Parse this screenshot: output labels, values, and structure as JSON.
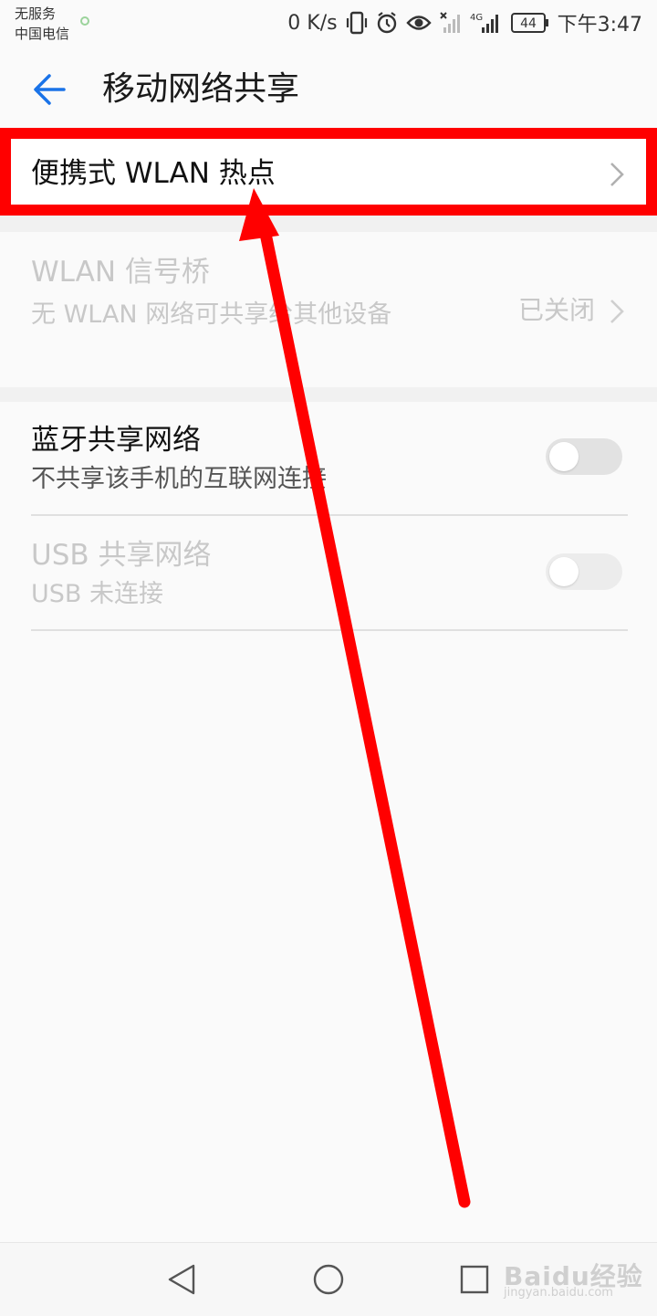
{
  "status_bar": {
    "carrier_line1": "无服务",
    "carrier_line2": "中国电信",
    "speed": "0 K/s",
    "network_type": "4G",
    "battery": "44",
    "time": "下午3:47"
  },
  "header": {
    "title": "移动网络共享"
  },
  "items": {
    "hotspot": {
      "label": "便携式 WLAN 热点"
    },
    "wlan_bridge": {
      "label": "WLAN 信号桥",
      "subtitle": "无 WLAN 网络可共享给其他设备",
      "value": "已关闭",
      "enabled": false
    },
    "bluetooth": {
      "label": "蓝牙共享网络",
      "subtitle": "不共享该手机的互联网连接",
      "on": false
    },
    "usb": {
      "label": "USB 共享网络",
      "subtitle": "USB 未连接",
      "on": false,
      "enabled": false
    }
  },
  "annotation": {
    "highlight_color": "#ff0000"
  },
  "watermark": {
    "text": "Baidu经验",
    "url": "jingyan.baidu.com"
  }
}
